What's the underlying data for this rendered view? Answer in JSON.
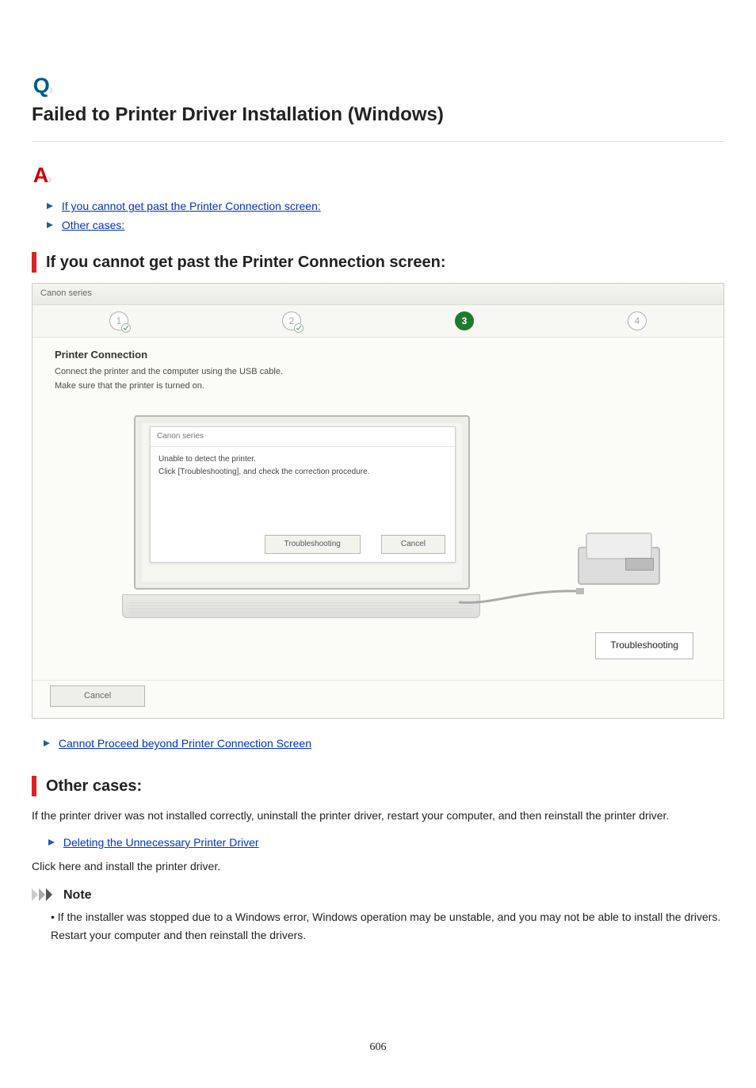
{
  "qa_icons": {
    "q": "Q",
    "a": "A"
  },
  "title": "Failed to Printer Driver Installation (Windows)",
  "top_links": [
    "If you cannot get past the Printer Connection screen:",
    "Other cases:"
  ],
  "section_1_heading": "If you cannot get past the Printer Connection screen:",
  "wizard": {
    "titlebar": "Canon            series",
    "step_labels": [
      "1",
      "2",
      "3",
      "4"
    ],
    "active_step_index": 2,
    "body_head": "Printer Connection",
    "body_sub_1": "Connect the printer and the computer using the USB cable.",
    "body_sub_2": "Make sure that the printer is turned on.",
    "dlg_title": "Canon            series",
    "dlg_line_1": "Unable to detect the printer.",
    "dlg_line_2": "Click [Troubleshooting], and check the correction procedure.",
    "dlg_btn_troubleshooting": "Troubleshooting",
    "dlg_btn_cancel": "Cancel",
    "troubleshoot_btn": "Troubleshooting",
    "cancel_btn": "Cancel"
  },
  "section_1_link": "Cannot Proceed beyond Printer Connection Screen",
  "section_2_heading": "Other cases:",
  "section_2_para": "If the printer driver was not installed correctly, uninstall the printer driver, restart your computer, and then reinstall the printer driver.",
  "section_2_link": "Deleting the Unnecessary Printer Driver",
  "section_2_after": "Click here and install the printer driver.",
  "note_label": "Note",
  "note_bullet": "If the installer was stopped due to a Windows error, Windows operation may be unstable, and you may not be able to install the drivers. Restart your computer and then reinstall the drivers.",
  "page_number": "606"
}
